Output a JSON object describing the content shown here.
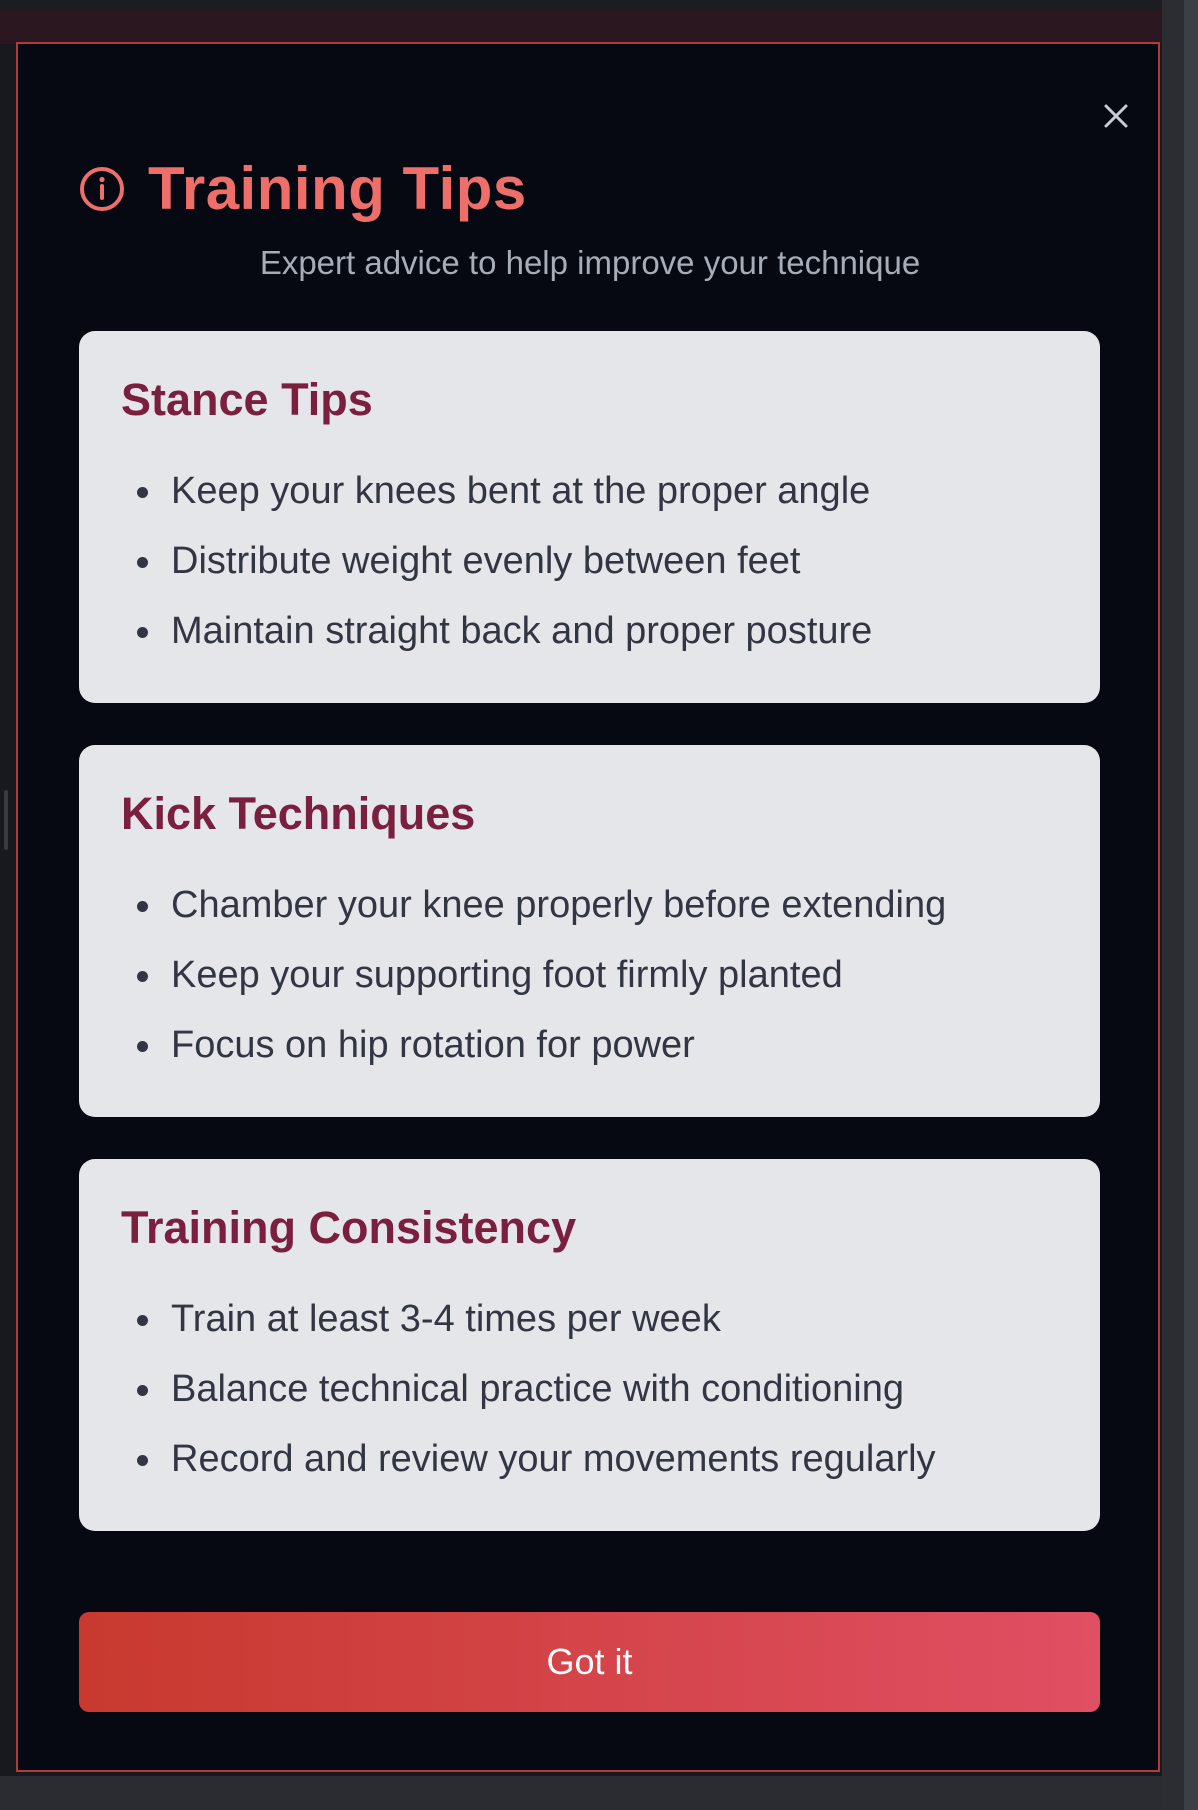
{
  "modal": {
    "title": "Training Tips",
    "subtitle": "Expert advice to help improve your technique",
    "close_icon": "close-icon",
    "info_icon": "info-circle-icon",
    "accent_color": "#ee6e6a",
    "sections": [
      {
        "title": "Stance Tips",
        "items": [
          "Keep your knees bent at the proper angle",
          "Distribute weight evenly between feet",
          "Maintain straight back and proper posture"
        ]
      },
      {
        "title": "Kick Techniques",
        "items": [
          "Chamber your knee properly before extending",
          "Keep your supporting foot firmly planted",
          "Focus on hip rotation for power"
        ]
      },
      {
        "title": "Training Consistency",
        "items": [
          "Train at least 3-4 times per week",
          "Balance technical practice with conditioning",
          "Record and review your movements regularly"
        ]
      }
    ],
    "button_label": "Got it"
  }
}
